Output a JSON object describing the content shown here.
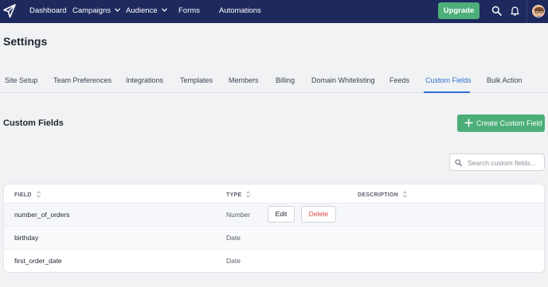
{
  "nav": {
    "items": [
      {
        "label": "Dashboard",
        "dropdown": false
      },
      {
        "label": "Campaigns",
        "dropdown": true
      },
      {
        "label": "Audience",
        "dropdown": true
      },
      {
        "label": "Forms",
        "dropdown": false
      },
      {
        "label": "Automations",
        "dropdown": false
      }
    ],
    "upgrade_label": "Upgrade",
    "icons": [
      "logo-paper-plane-icon",
      "search-icon",
      "bell-icon",
      "avatar"
    ]
  },
  "page": {
    "title": "Settings"
  },
  "tabs": [
    {
      "label": "Site Setup",
      "active": false
    },
    {
      "label": "Team Preferences",
      "active": false
    },
    {
      "label": "Integrations",
      "active": false
    },
    {
      "label": "Templates",
      "active": false
    },
    {
      "label": "Members",
      "active": false
    },
    {
      "label": "Billing",
      "active": false
    },
    {
      "label": "Domain Whitelisting",
      "active": false
    },
    {
      "label": "Feeds",
      "active": false
    },
    {
      "label": "Custom Fields",
      "active": true
    },
    {
      "label": "Bulk Action",
      "active": false
    }
  ],
  "section": {
    "title": "Custom Fields",
    "create_label": "Create Custom Field"
  },
  "search": {
    "placeholder": "Search custom fields...",
    "value": ""
  },
  "table": {
    "columns": [
      "FIELD",
      "TYPE",
      "DESCRIPTION"
    ],
    "rows": [
      {
        "field": "number_of_orders",
        "type": "Number",
        "description": ""
      },
      {
        "field": "birthday",
        "type": "Date",
        "description": ""
      },
      {
        "field": "first_order_date",
        "type": "Date",
        "description": ""
      }
    ],
    "row_actions": {
      "edit_label": "Edit",
      "delete_label": "Delete"
    }
  },
  "colors": {
    "nav_bg": "#1e2a5e",
    "accent_green": "#4caf7a",
    "active_tab": "#2f6fd1",
    "delete_red": "#d8453c"
  }
}
